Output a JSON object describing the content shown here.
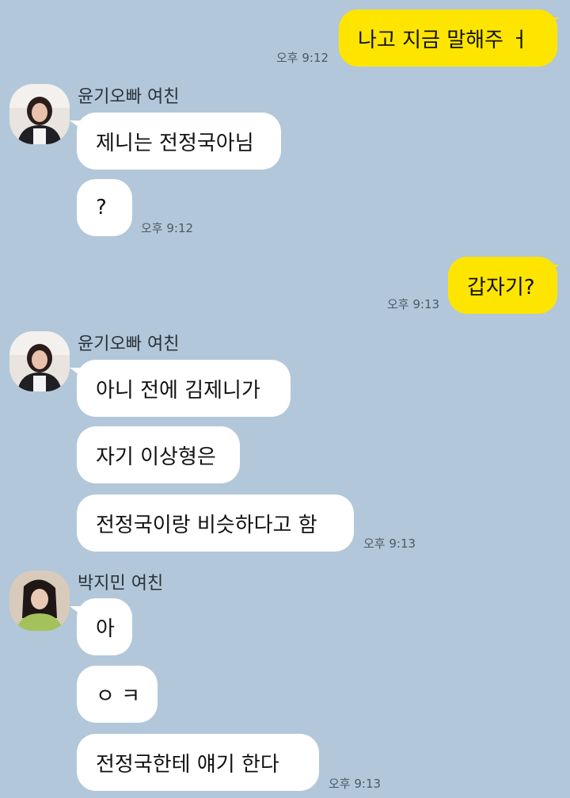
{
  "messages": {
    "m1": {
      "text": "나고 지금 말해주 ㅓ",
      "time": "오후 9:12"
    },
    "g1": {
      "sender": "윤기오빠 여친",
      "b1": "제니는 전정국아님",
      "b2": "?",
      "time": "오후 9:12"
    },
    "m2": {
      "text": "갑자기?",
      "time": "오후 9:13"
    },
    "g2": {
      "sender": "윤기오빠 여친",
      "b1": "아니 전에 김제니가",
      "b2": "자기 이상형은",
      "b3": "전정국이랑 비슷하다고 함",
      "time": "오후 9:13"
    },
    "g3": {
      "sender": "박지민 여친",
      "b1": "아",
      "b2": "ㅇ ㅋ",
      "b3": "전정국한테 얘기 한다",
      "time": "오후 9:13"
    }
  },
  "colors": {
    "background": "#b2c7d9",
    "outgoing_bubble": "#fee500",
    "incoming_bubble": "#ffffff"
  }
}
